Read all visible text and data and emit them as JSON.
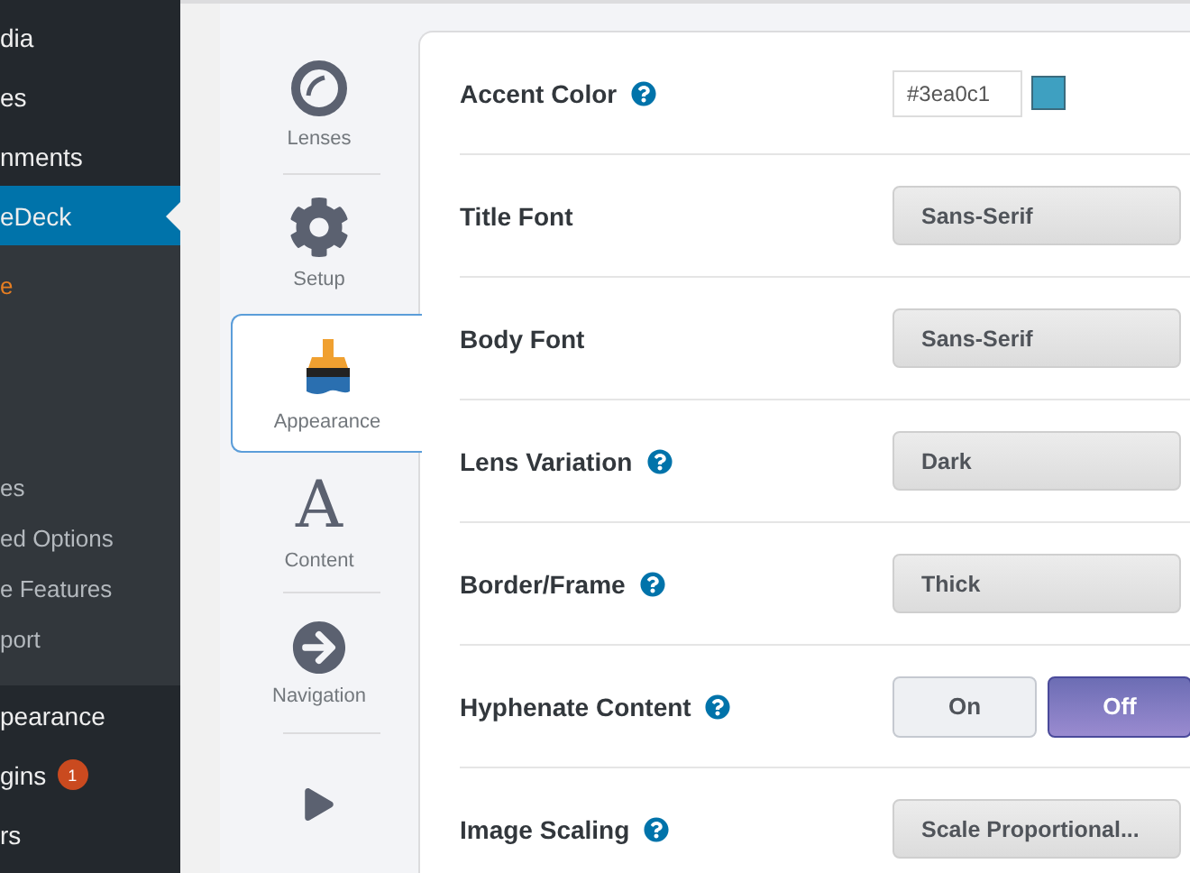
{
  "sidebar": {
    "items": [
      {
        "label": "dia",
        "kind": "main",
        "selected": false
      },
      {
        "label": "es",
        "kind": "main",
        "selected": false
      },
      {
        "label": "nments",
        "kind": "main",
        "selected": false
      },
      {
        "label": "eDeck",
        "kind": "main",
        "selected": true
      },
      {
        "label": "e",
        "kind": "sub",
        "selected": true
      },
      {
        "label": "es",
        "kind": "sub",
        "selected": false
      },
      {
        "label": "ed Options",
        "kind": "sub",
        "selected": false
      },
      {
        "label": "e Features",
        "kind": "sub",
        "selected": false
      },
      {
        "label": "port",
        "kind": "sub",
        "selected": false
      },
      {
        "label": "pearance",
        "kind": "main",
        "selected": false
      },
      {
        "label": "gins",
        "kind": "main",
        "selected": false,
        "badge": "1"
      },
      {
        "label": "rs",
        "kind": "main",
        "selected": false
      }
    ]
  },
  "tabs": [
    {
      "label": "Lenses",
      "kind": "ring",
      "selected": false
    },
    {
      "label": "Setup",
      "kind": "gear",
      "selected": false
    },
    {
      "label": "Appearance",
      "kind": "brush",
      "selected": true
    },
    {
      "label": "Content",
      "kind": "letter",
      "glyph": "A",
      "selected": false
    },
    {
      "label": "Navigation",
      "kind": "arrow",
      "selected": false
    },
    {
      "kind": "play",
      "selected": false
    }
  ],
  "settings": [
    {
      "label": "Accent Color",
      "help": true,
      "kind": "color",
      "value": "#3ea0c1",
      "color": "#3ea0c1"
    },
    {
      "label": "Title Font",
      "help": false,
      "kind": "select",
      "value": "Sans-Serif"
    },
    {
      "label": "Body Font",
      "help": false,
      "kind": "select",
      "value": "Sans-Serif"
    },
    {
      "label": "Lens Variation",
      "help": true,
      "kind": "select",
      "value": "Dark"
    },
    {
      "label": "Border/Frame",
      "help": true,
      "kind": "select",
      "value": "Thick"
    },
    {
      "label": "Hyphenate Content",
      "help": true,
      "kind": "toggle",
      "options": [
        {
          "label": "On",
          "selected": false
        },
        {
          "label": "Off",
          "selected": true
        }
      ]
    },
    {
      "label": "Image Scaling",
      "help": true,
      "kind": "select",
      "value": "Scale Proportional..."
    }
  ]
}
